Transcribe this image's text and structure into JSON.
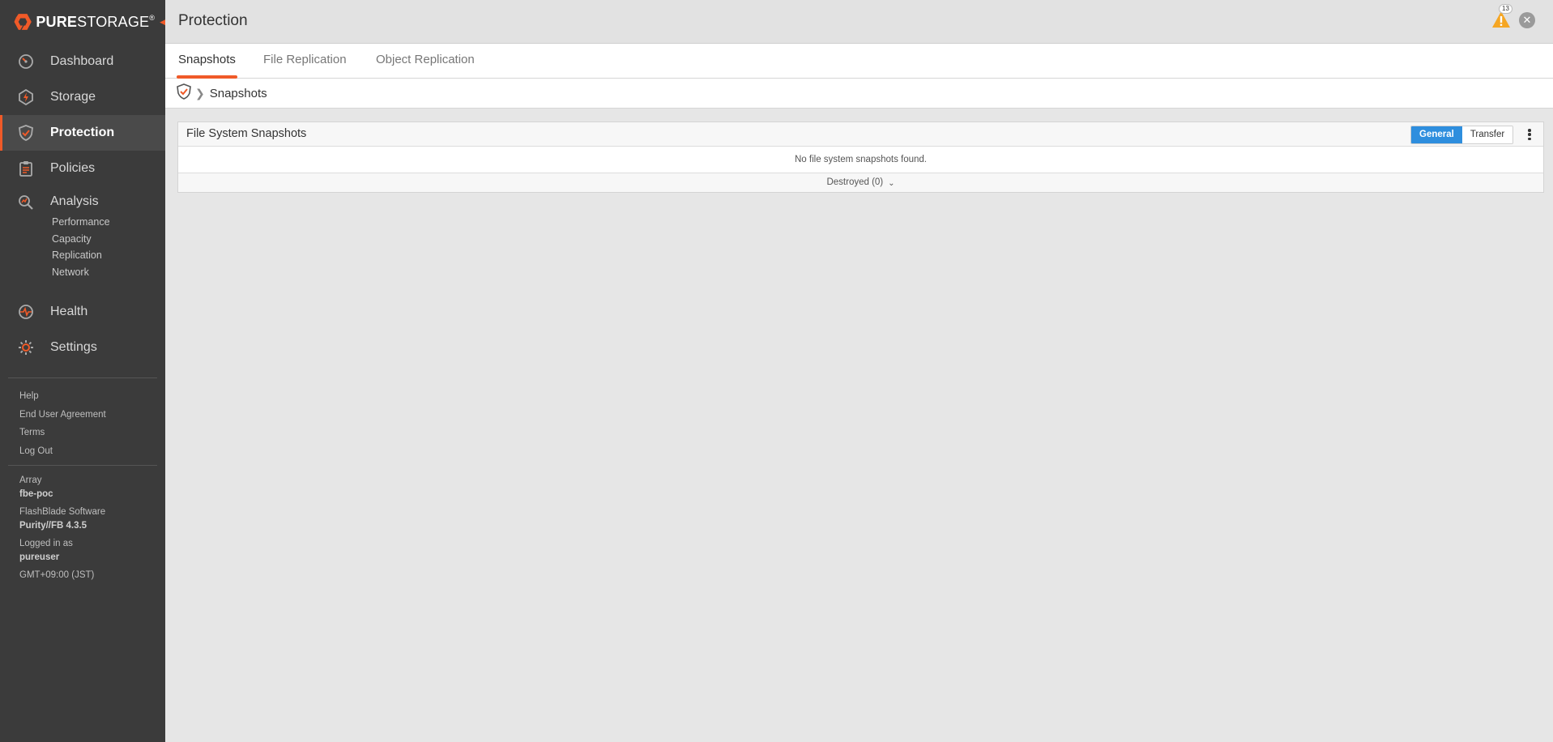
{
  "brand": {
    "bold": "PURE",
    "light": "STORAGE",
    "reg": "®",
    "color": "#f05a28"
  },
  "sidebar": {
    "nav": [
      {
        "label": "Dashboard",
        "icon": "dashboard-icon"
      },
      {
        "label": "Storage",
        "icon": "storage-icon"
      },
      {
        "label": "Protection",
        "icon": "protection-shield-icon",
        "active": true
      },
      {
        "label": "Policies",
        "icon": "policies-clipboard-icon"
      },
      {
        "label": "Analysis",
        "icon": "analysis-magnifier-icon"
      },
      {
        "label": "Health",
        "icon": "health-pulse-icon"
      },
      {
        "label": "Settings",
        "icon": "settings-gear-icon"
      }
    ],
    "analysis_sub": [
      "Performance",
      "Capacity",
      "Replication",
      "Network"
    ],
    "links": [
      "Help",
      "End User Agreement",
      "Terms",
      "Log Out"
    ],
    "info": {
      "array_label": "Array",
      "array_value": "fbe-poc",
      "software_label": "FlashBlade Software",
      "software_value": "Purity//FB 4.3.5",
      "logged_label": "Logged in as",
      "logged_value": "pureuser",
      "timezone": "GMT+09:00 (JST)"
    }
  },
  "header": {
    "title": "Protection",
    "alert_count": "13"
  },
  "tabs": [
    "Snapshots",
    "File Replication",
    "Object Replication"
  ],
  "breadcrumb": {
    "current": "Snapshots"
  },
  "panel": {
    "title": "File System Snapshots",
    "toggle": [
      "General",
      "Transfer"
    ],
    "empty_message": "No file system snapshots found.",
    "destroyed_label": "Destroyed (0)"
  }
}
